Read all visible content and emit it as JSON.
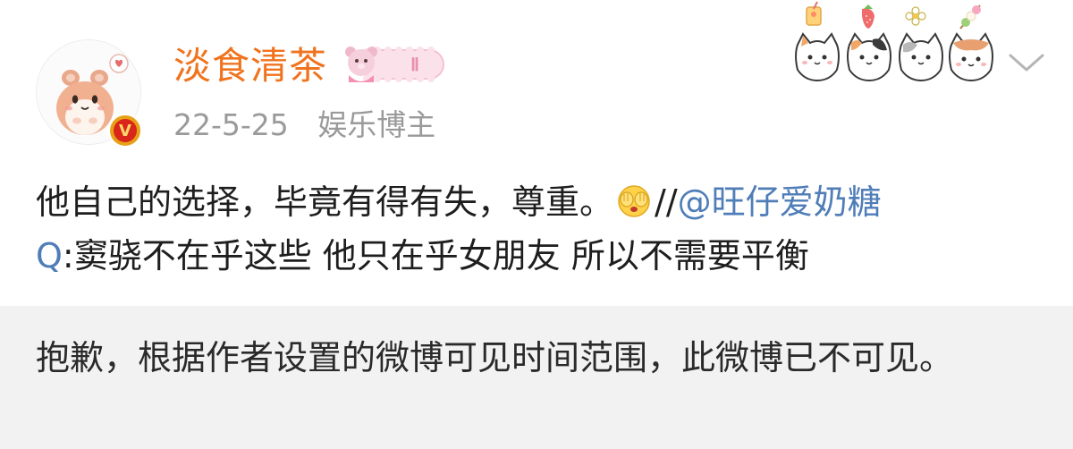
{
  "post": {
    "author": {
      "name": "淡食清茶",
      "avatar_icon": "hamster-avatar-icon",
      "verified_badge_icon": "verified-v-badge-icon",
      "member_badge_icon": "member-level-badge-icon",
      "member_level": "Ⅱ"
    },
    "meta": {
      "time": "22-5-25",
      "tag": "娱乐博主"
    },
    "more_icon": "chevron-down-icon",
    "decor_icon": "cat-stickers-decoration",
    "content": {
      "line1_text": "他自己的选择，毕竟有得有失，尊重。",
      "emoji": "facepalm-emoji",
      "separator": "//",
      "mention": "@旺仔爱奶糖",
      "line2_prefix": "Q",
      "line2_text": ":窦骁不在乎这些 他只在乎女朋友 所以不需要平衡"
    },
    "notice": {
      "text": "抱歉，根据作者设置的微博可见时间范围，此微博已不可见。"
    },
    "colors": {
      "username": "#f0731e",
      "mention": "#4f7db8",
      "meta": "#9a9a9a",
      "notice_bg": "#f2f2f2"
    }
  }
}
